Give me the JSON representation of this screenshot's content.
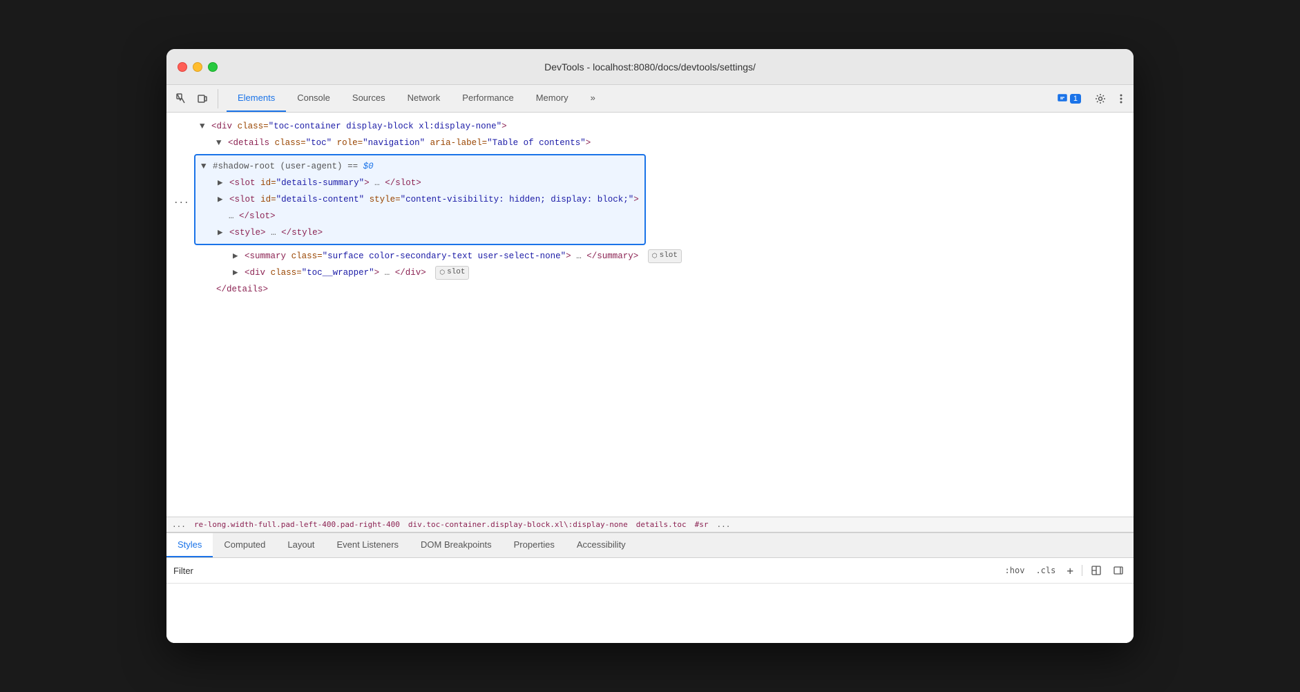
{
  "window": {
    "title": "DevTools - localhost:8080/docs/devtools/settings/"
  },
  "toolbar": {
    "tabs": [
      {
        "id": "elements",
        "label": "Elements",
        "active": true
      },
      {
        "id": "console",
        "label": "Console",
        "active": false
      },
      {
        "id": "sources",
        "label": "Sources",
        "active": false
      },
      {
        "id": "network",
        "label": "Network",
        "active": false
      },
      {
        "id": "performance",
        "label": "Performance",
        "active": false
      },
      {
        "id": "memory",
        "label": "Memory",
        "active": false
      }
    ],
    "more_label": "»",
    "notification_count": "1",
    "settings_title": "Settings",
    "more_menu_title": "More"
  },
  "dom": {
    "line1": "▼ <div class=\"toc-container display-block xl:display-none\">",
    "line2": "▼ <details class=\"toc\" role=\"navigation\" aria-label=\"Table of contents\">",
    "dots": "...",
    "shadow_root": {
      "header": "▼ #shadow-root (user-agent) == $0",
      "slot1": "▶ <slot id=\"details-summary\">…</slot>",
      "slot2": "▶ <slot id=\"details-content\" style=\"content-visibility: hidden; display: block;\">",
      "slot2_end": "…</slot>",
      "style": "▶ <style>…</style>"
    },
    "summary": "▶ <summary class=\"surface color-secondary-text user-select-none\">…</summary>",
    "slot_badge_1": "slot",
    "div_wrapper": "▶ <div class=\"toc__wrapper\">…</div>",
    "slot_badge_2": "slot",
    "details_end": "</details>"
  },
  "breadcrumb": {
    "dots": "...",
    "item1": "re-long.width-full.pad-left-400.pad-right-400",
    "item2": "div.toc-container.display-block.xl\\:display-none",
    "item3": "details.toc",
    "item4": "#sr",
    "more": "..."
  },
  "bottom_panel": {
    "tabs": [
      {
        "id": "styles",
        "label": "Styles",
        "active": true
      },
      {
        "id": "computed",
        "label": "Computed",
        "active": false
      },
      {
        "id": "layout",
        "label": "Layout",
        "active": false
      },
      {
        "id": "event-listeners",
        "label": "Event Listeners",
        "active": false
      },
      {
        "id": "dom-breakpoints",
        "label": "DOM Breakpoints",
        "active": false
      },
      {
        "id": "properties",
        "label": "Properties",
        "active": false
      },
      {
        "id": "accessibility",
        "label": "Accessibility",
        "active": false
      }
    ],
    "filter": {
      "label": "Filter",
      "hov_label": ":hov",
      "cls_label": ".cls",
      "plus_label": "+",
      "icon1": "layout-icon",
      "icon2": "sidebar-icon"
    }
  }
}
